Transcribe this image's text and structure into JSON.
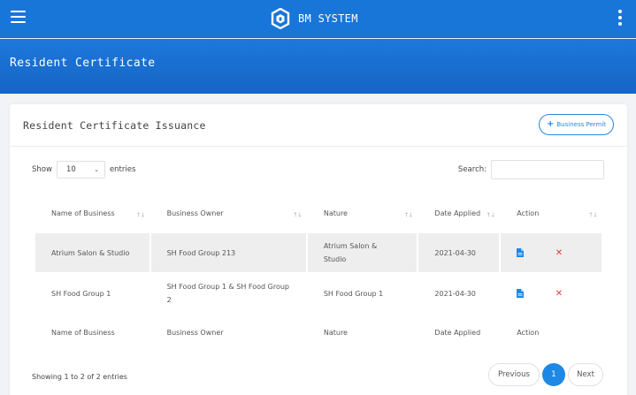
{
  "app": {
    "title": "BM SYSTEM",
    "colors": {
      "primary": "#1976d9",
      "accent": "#1e88e5",
      "danger": "#e23b3b"
    }
  },
  "topbar": {
    "menu_icon": "hamburger-menu-icon",
    "logo_icon": "shield-logo-icon",
    "more_icon": "kebab-menu-icon"
  },
  "header": {
    "page_title": "Resident Certificate"
  },
  "card": {
    "title": "Resident Certificate Issuance",
    "add_button_label": "Business Permit"
  },
  "controls": {
    "show_label": "Show",
    "entries_value": "10",
    "entries_label": "entries",
    "search_label": "Search:",
    "search_value": ""
  },
  "table": {
    "columns": [
      "Name of Business",
      "Business Owner",
      "Nature",
      "Date Applied",
      "Action"
    ],
    "rows": [
      {
        "name": "Atrium Salon & Studio",
        "owner": "SH Food Group 213",
        "nature": "Atrium Salon & Studio",
        "date": "2021-04-30"
      },
      {
        "name": "SH Food Group 1",
        "owner": "SH Food Group 1 & SH Food Group 2",
        "nature": "SH Food Group 1",
        "date": "2021-04-30"
      }
    ]
  },
  "footer": {
    "info": "Showing 1 to 2 of 2 entries",
    "prev_label": "Previous",
    "page": "1",
    "next_label": "Next"
  }
}
